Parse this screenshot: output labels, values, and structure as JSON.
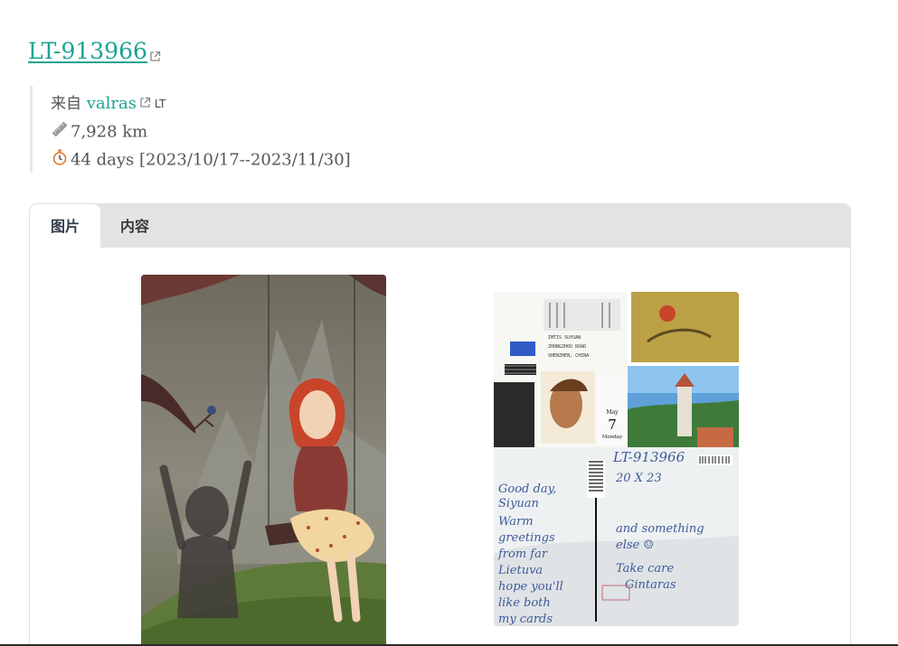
{
  "postcard": {
    "id": "LT-913966"
  },
  "meta": {
    "from_label": "来自",
    "sender": "valras",
    "country_code": "LT",
    "distance": "7,928 km",
    "duration": "44 days [2023/10/17--2023/11/30]"
  },
  "tabs": [
    {
      "label": "图片",
      "active": true
    },
    {
      "label": "内容",
      "active": false
    }
  ],
  "icons": {
    "external_link": "external-link-icon",
    "distance": "ruler-icon",
    "duration": "stopwatch-icon"
  },
  "colors": {
    "link": "#1aa393",
    "tab_bar": "#e3e3e3"
  },
  "back_card": {
    "postcard_id": "LT-913966",
    "date": "20 X 23",
    "stamp_date_month": "May",
    "stamp_date_day": "7",
    "stamp_date_weekday": "Monday"
  }
}
